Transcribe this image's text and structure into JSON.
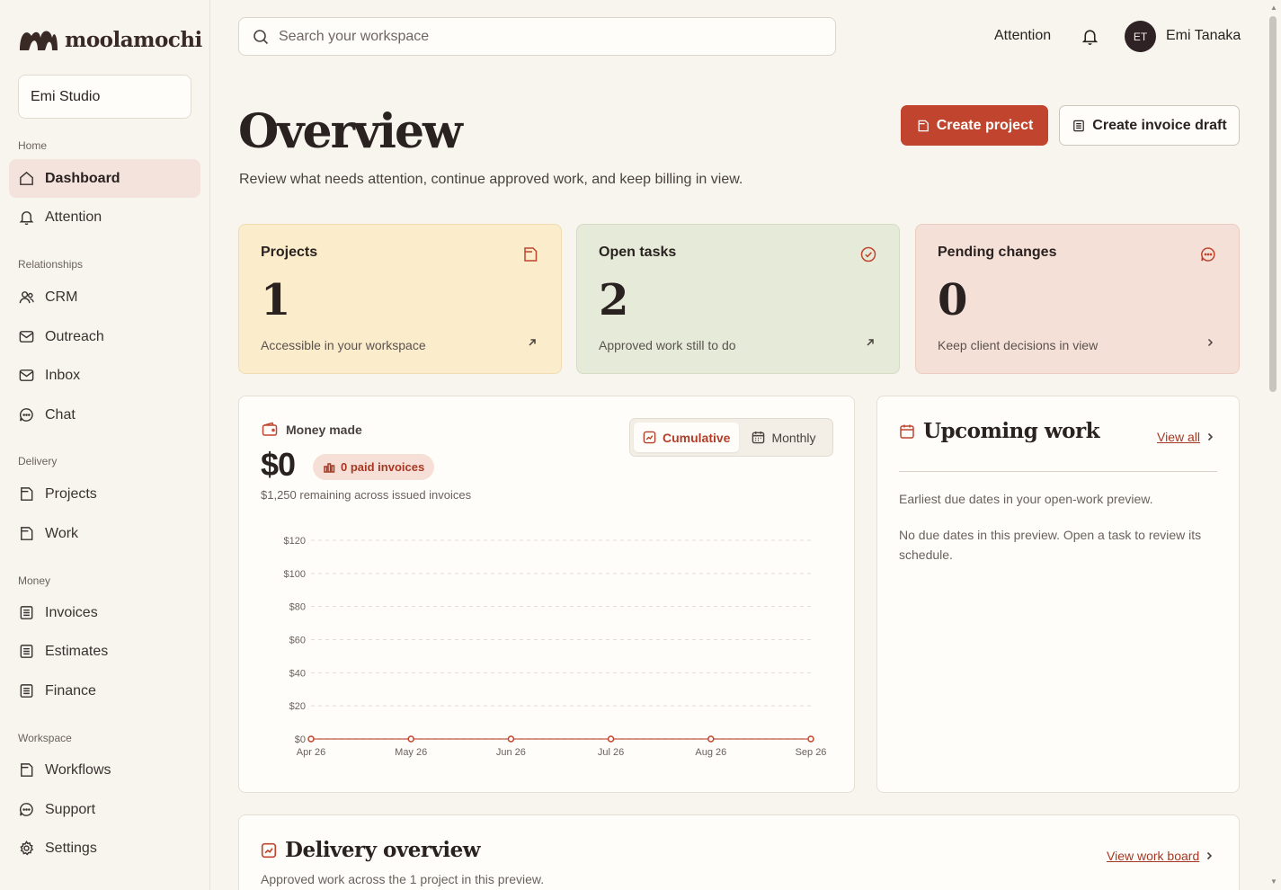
{
  "brand": {
    "name": "moolamochi"
  },
  "workspace": {
    "name": "Emi Studio"
  },
  "sidebar": {
    "sections": [
      {
        "label": "Home",
        "items": [
          {
            "label": "Dashboard",
            "icon": "home-icon",
            "active": true
          },
          {
            "label": "Attention",
            "icon": "bell-icon"
          }
        ]
      },
      {
        "label": "Relationships",
        "items": [
          {
            "label": "CRM",
            "icon": "users-icon"
          },
          {
            "label": "Outreach",
            "icon": "mail-icon"
          },
          {
            "label": "Inbox",
            "icon": "inbox-icon"
          },
          {
            "label": "Chat",
            "icon": "chat-icon"
          }
        ]
      },
      {
        "label": "Delivery",
        "items": [
          {
            "label": "Projects",
            "icon": "folder-icon"
          },
          {
            "label": "Work",
            "icon": "folder-icon"
          }
        ]
      },
      {
        "label": "Money",
        "items": [
          {
            "label": "Invoices",
            "icon": "document-icon"
          },
          {
            "label": "Estimates",
            "icon": "document-icon"
          },
          {
            "label": "Finance",
            "icon": "document-icon"
          }
        ]
      },
      {
        "label": "Workspace",
        "items": [
          {
            "label": "Workflows",
            "icon": "folder-icon"
          },
          {
            "label": "Support",
            "icon": "chat-icon"
          },
          {
            "label": "Settings",
            "icon": "gear-icon"
          }
        ]
      }
    ]
  },
  "topbar": {
    "search_placeholder": "Search your workspace",
    "attention_label": "Attention",
    "user": {
      "initials": "ET",
      "name": "Emi Tanaka"
    }
  },
  "header": {
    "title": "Overview",
    "subtitle": "Review what needs attention, continue approved work, and keep billing in view.",
    "primary_button": "Create project",
    "secondary_button": "Create invoice draft"
  },
  "stats": {
    "projects": {
      "label": "Projects",
      "value": "1",
      "note": "Accessible in your workspace"
    },
    "tasks": {
      "label": "Open tasks",
      "value": "2",
      "note": "Approved work still to do"
    },
    "pending": {
      "label": "Pending changes",
      "value": "0",
      "note": "Keep client decisions in view"
    }
  },
  "money": {
    "title": "Money made",
    "value": "$0",
    "pill": "0 paid invoices",
    "subtitle": "$1,250 remaining across issued invoices",
    "toggle": {
      "cumulative": "Cumulative",
      "monthly": "Monthly",
      "selected": "Cumulative"
    }
  },
  "chart_data": {
    "type": "line",
    "categories": [
      "Apr 26",
      "May 26",
      "Jun 26",
      "Jul 26",
      "Aug 26",
      "Sep 26"
    ],
    "values": [
      0,
      0,
      0,
      0,
      0,
      0
    ],
    "y_ticks": [
      "$0",
      "$20",
      "$40",
      "$60",
      "$80",
      "$100",
      "$120"
    ],
    "ylim": [
      0,
      120
    ],
    "grid": true,
    "line_color": "#c0442e"
  },
  "upcoming": {
    "title": "Upcoming work",
    "view_all": "View all",
    "p1": "Earliest due dates in your open-work preview.",
    "p2": "No due dates in this preview. Open a task to review its schedule."
  },
  "delivery": {
    "title": "Delivery overview",
    "subtitle": "Approved work across the 1 project in this preview.",
    "view_board": "View work board"
  }
}
